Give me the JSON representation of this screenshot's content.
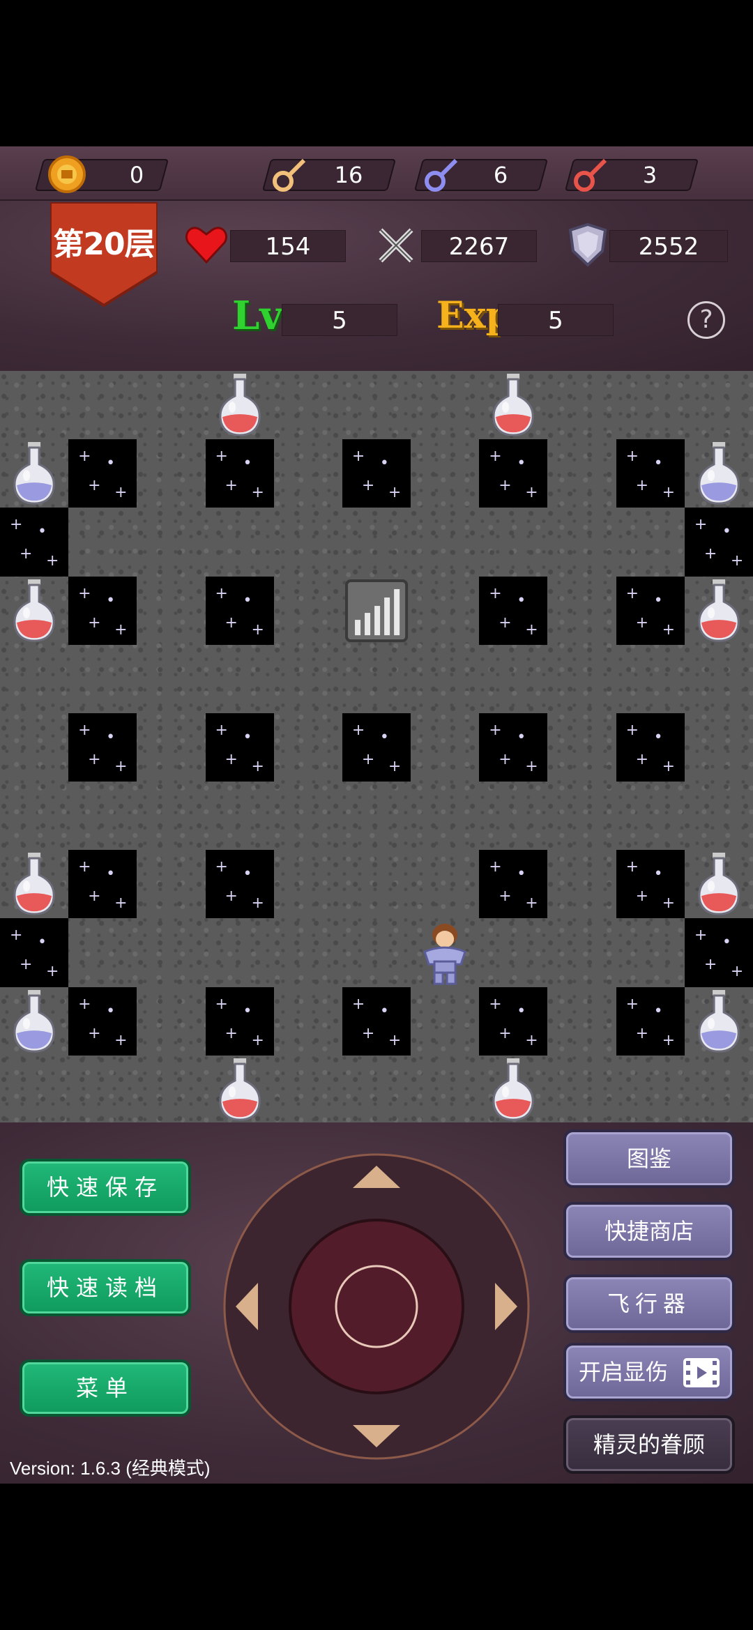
{
  "resources": {
    "gold": "0",
    "yellow_keys": "16",
    "blue_keys": "6",
    "red_keys": "3"
  },
  "floor": {
    "label": "第20层"
  },
  "stats": {
    "hp": "154",
    "attack": "2267",
    "defense": "2552",
    "level_label": "Lv",
    "level": "5",
    "exp_label": "Exp",
    "exp": "5",
    "help": "?"
  },
  "board": {
    "grid_cols": 11,
    "grid_rows": 11,
    "rows": [
      ".  .  .  P  .  .  .  P  .  .  .",
      "B  V  .  V  .  V  .  V  .  V  B",
      "V  .  .  .  .  .  .  .  .  .  V",
      "P  V  .  V  .  S  .  V  .  V  P",
      ".  .  .  .  .  .  .  .  .  .  .",
      ".  V  .  V  .  V  .  V  .  V  .",
      ".  .  .  .  .  .  .  .  .  .  .",
      "P  V  .  V  .  .  .  V  .  V  P",
      "V  .  .  .  .  .  H  .  .  .  V",
      "B  V  .  V  .  V  .  V  .  V  B",
      ".  .  .  P  .  .  .  P  .  .  ."
    ],
    "legend": {
      "V": "starry-void",
      "P": "red-potion",
      "B": "blue-potion",
      "S": "upstairs",
      "H": "hero"
    },
    "colors": {
      "red_potion": "#e85a5a",
      "blue_potion": "#9a9ae0"
    }
  },
  "controls": {
    "quick_save": "快速保存",
    "quick_load": "快速读档",
    "menu": "菜单",
    "encyclopedia": "图鉴",
    "quick_shop": "快捷商店",
    "flyer": "飞行器",
    "show_damage": "开启显伤",
    "fairy_blessing": "精灵的眷顾"
  },
  "version": "Version: 1.6.3 (经典模式)"
}
